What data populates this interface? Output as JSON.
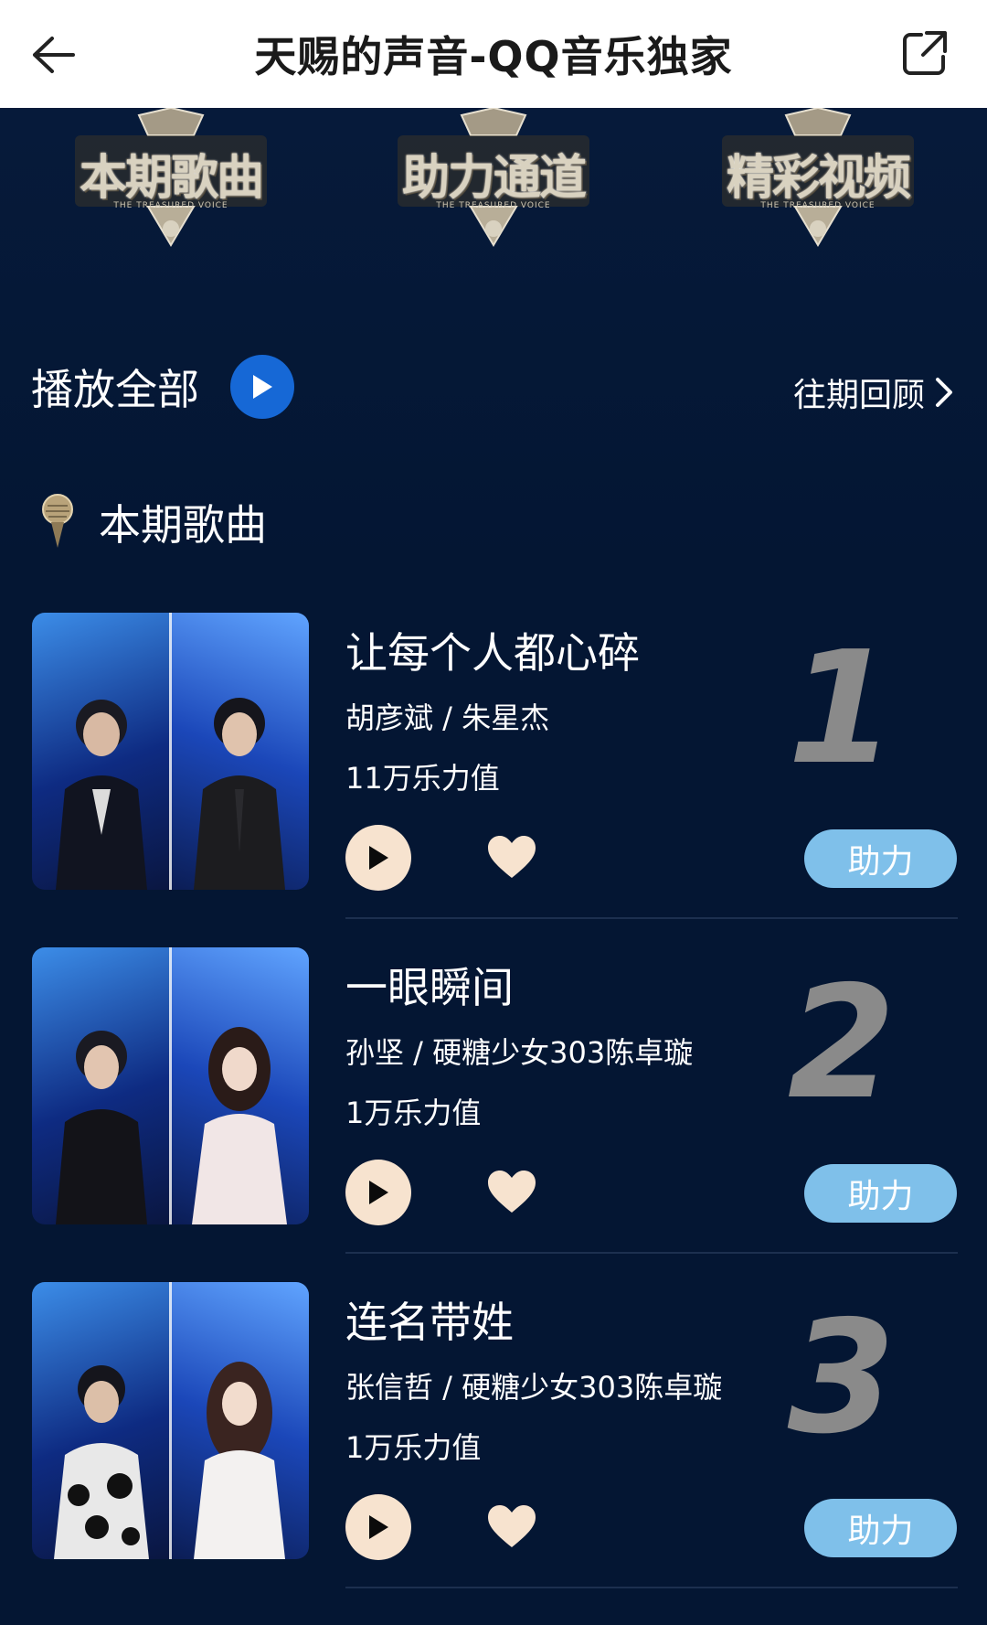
{
  "header": {
    "title": "天赐的声音-QQ音乐独家",
    "back_icon": "arrow-left-icon",
    "share_icon": "external-share-icon"
  },
  "badges": [
    {
      "label": "本期歌曲",
      "sub": "THE TREASURED VOICE"
    },
    {
      "label": "助力通道",
      "sub": "THE TREASURED VOICE"
    },
    {
      "label": "精彩视频",
      "sub": "THE TREASURED VOICE"
    }
  ],
  "controls": {
    "play_all_label": "播放全部",
    "history_label": "往期回顾"
  },
  "section": {
    "title": "本期歌曲"
  },
  "songs": [
    {
      "rank": "1",
      "name": "让每个人都心碎",
      "artists": "胡彦斌 / 朱星杰",
      "power": "11万乐力值",
      "assist_label": "助力"
    },
    {
      "rank": "2",
      "name": "一眼瞬间",
      "artists": "孙坚 / 硬糖少女303陈卓璇",
      "power": "1万乐力值",
      "assist_label": "助力"
    },
    {
      "rank": "3",
      "name": "连名带姓",
      "artists": "张信哲 / 硬糖少女303陈卓璇",
      "power": "1万乐力值",
      "assist_label": "助力"
    }
  ],
  "colors": {
    "background": "#041633",
    "accent_blue": "#1668d6",
    "assist_button": "#7fc0ea",
    "play_button": "#f7e3cf",
    "rank_number": "#8a8a8a"
  }
}
